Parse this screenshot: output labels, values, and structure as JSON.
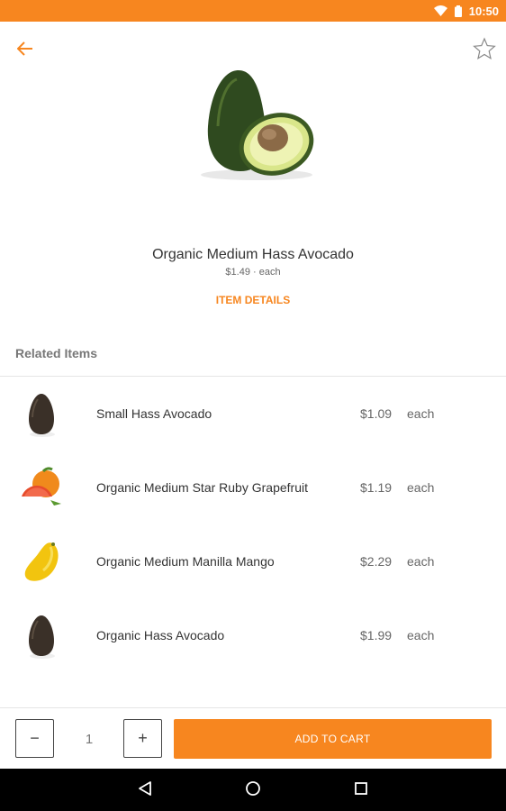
{
  "status_bar": {
    "time": "10:50",
    "icons": [
      "wifi-icon",
      "battery-icon"
    ]
  },
  "toolbar": {
    "back_icon": "arrow-left-icon",
    "favorite_icon": "star-outline-icon"
  },
  "product": {
    "name": "Organic Medium Hass Avocado",
    "price": "$1.49 · each",
    "details_label": "ITEM DETAILS"
  },
  "related": {
    "title": "Related Items",
    "items": [
      {
        "name": "Small Hass Avocado",
        "price": "$1.09",
        "unit": "each",
        "icon": "avocado-icon"
      },
      {
        "name": "Organic Medium Star Ruby Grapefruit",
        "price": "$1.19",
        "unit": "each",
        "icon": "grapefruit-icon"
      },
      {
        "name": "Organic Medium Manilla Mango",
        "price": "$2.29",
        "unit": "each",
        "icon": "mango-icon"
      },
      {
        "name": "Organic Hass Avocado",
        "price": "$1.99",
        "unit": "each",
        "icon": "avocado-icon"
      }
    ]
  },
  "cart": {
    "minus_label": "−",
    "quantity": "1",
    "plus_label": "+",
    "add_label": "ADD TO CART"
  },
  "colors": {
    "accent": "#f7861f",
    "nav_bar": "#000000"
  }
}
